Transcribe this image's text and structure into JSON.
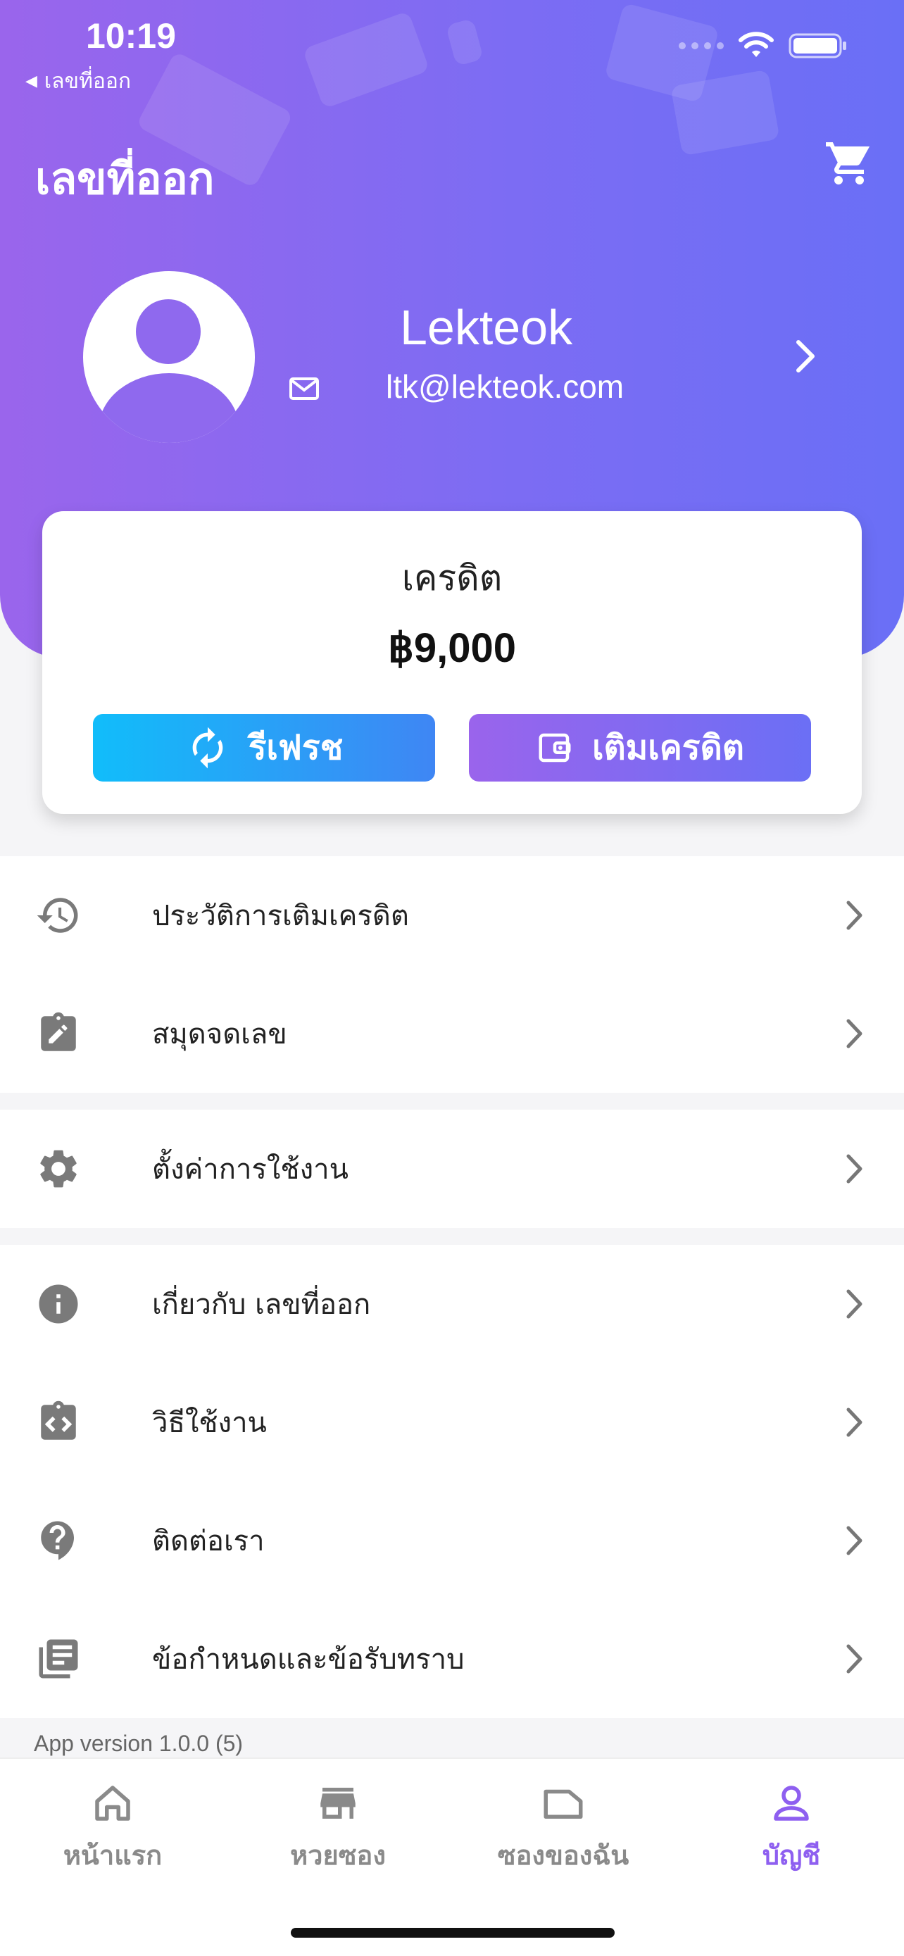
{
  "status_bar": {
    "time": "10:19",
    "back_label": "เลขที่ออก"
  },
  "header": {
    "title": "เลขที่ออก",
    "cart_icon": "cart-icon"
  },
  "profile": {
    "name": "Lekteok",
    "email": "ltk@lekteok.com"
  },
  "credit": {
    "label": "เครดิต",
    "value": "฿9,000",
    "refresh_label": "รีเฟรช",
    "topup_label": "เติมเครดิต"
  },
  "menu_groups": [
    [
      {
        "icon": "history-icon",
        "label": "ประวัติการเติมเครดิต"
      },
      {
        "icon": "notebook-edit-icon",
        "label": "สมุดจดเลข"
      }
    ],
    [
      {
        "icon": "gear-icon",
        "label": "ตั้งค่าการใช้งาน"
      }
    ],
    [
      {
        "icon": "info-icon",
        "label": "เกี่ยวกับ เลขที่ออก"
      },
      {
        "icon": "code-badge-icon",
        "label": "วิธีใช้งาน"
      },
      {
        "icon": "help-bubble-icon",
        "label": "ติดต่อเรา"
      },
      {
        "icon": "document-list-icon",
        "label": "ข้อกำหนดและข้อรับทราบ"
      }
    ]
  ],
  "app_version": "App version 1.0.0 (5)",
  "tabs": [
    {
      "icon": "home-icon",
      "label": "หน้าแรก",
      "active": false
    },
    {
      "icon": "store-icon",
      "label": "หวยซอง",
      "active": false
    },
    {
      "icon": "envelope-folder-icon",
      "label": "ซองของฉัน",
      "active": false
    },
    {
      "icon": "person-icon",
      "label": "บัญชี",
      "active": true
    }
  ],
  "colors": {
    "gradient_start": "#9a65ec",
    "gradient_end": "#6a6ff6",
    "refresh_start": "#11bdfa",
    "refresh_end": "#3f86f4",
    "active_tab": "#8e5ff0",
    "icon_gray": "#7a7a7a"
  }
}
